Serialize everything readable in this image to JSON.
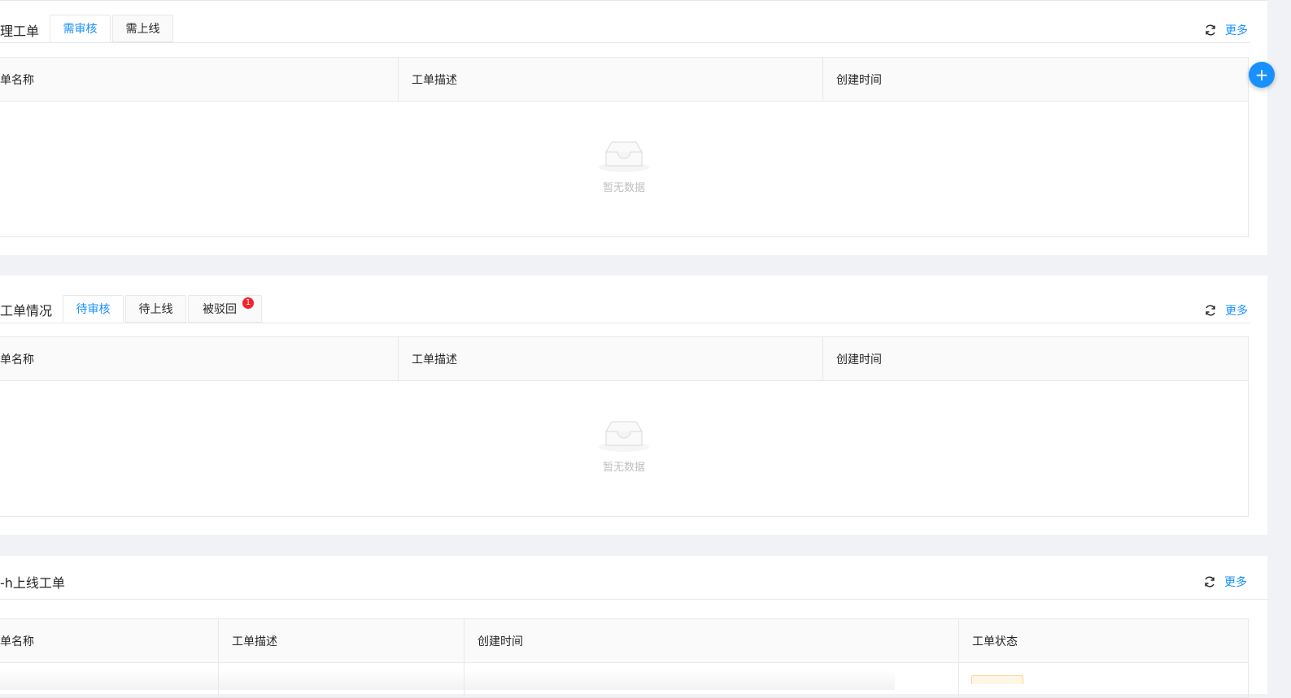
{
  "cards": [
    {
      "title": "理工单",
      "tabs": [
        {
          "label": "需审核",
          "active": true
        },
        {
          "label": "需上线",
          "active": false
        }
      ],
      "columns": [
        "单名称",
        "工单描述",
        "创建时间"
      ],
      "empty_text": "暂无数据",
      "more": "更多"
    },
    {
      "title": "工单情况",
      "tabs": [
        {
          "label": "待审核",
          "active": true
        },
        {
          "label": "待上线",
          "active": false
        },
        {
          "label": "被驳回",
          "active": false,
          "badge": "1"
        }
      ],
      "columns": [
        "单名称",
        "工单描述",
        "创建时间"
      ],
      "empty_text": "暂无数据",
      "more": "更多"
    },
    {
      "title": "-h上线工单",
      "columns": [
        "单名称",
        "工单描述",
        "创建时间",
        "工单状态"
      ],
      "more": "更多"
    }
  ],
  "fab_symbol": "+",
  "colors": {
    "accent": "#1890ff",
    "badge": "#f5222d",
    "background": "#f0f2f5"
  }
}
